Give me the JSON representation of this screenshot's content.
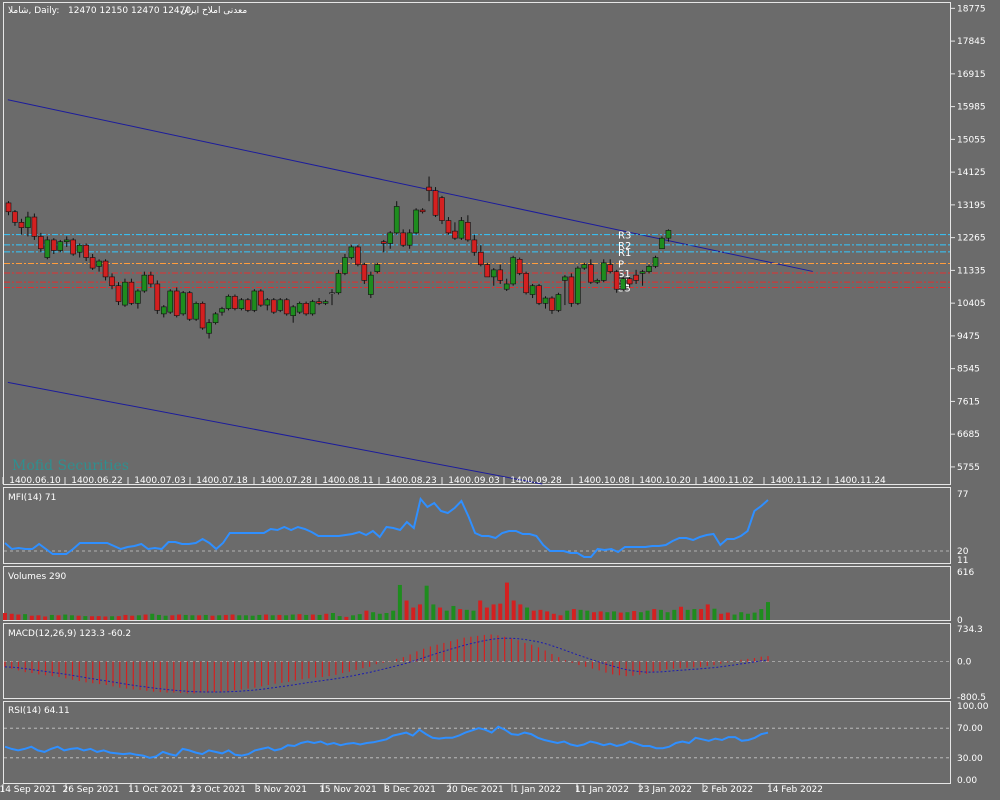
{
  "header": {
    "symbol": "شاملا, Daily:",
    "ohlc": "12470 12150 12470 12470",
    "name": "معدنی املاح ایران"
  },
  "watermark": "Mofid Securities",
  "colors": {
    "background": "#6b6b6b",
    "bull": "#1e8c1e",
    "bear": "#d42020",
    "trendline": "#1c1c9c",
    "pivot_r": "#33c8ff",
    "pivot_s": "#e03030",
    "pivot_p": "#ff9d3d",
    "indicator_line": "#2f8fff",
    "macd_signal": "#1c1cb0",
    "grid_level": "#c8c8c8"
  },
  "chart_data": [
    {
      "panel": "price",
      "type": "candlestick",
      "y_ticks": [
        18775,
        17845,
        16915,
        15985,
        15055,
        14125,
        13195,
        12265,
        11335,
        10405,
        9475,
        8545,
        7615,
        6685,
        5755
      ],
      "ylim": [
        5270,
        18870
      ],
      "x_labels_top": [
        "1400.06.10",
        "1400.06.22",
        "1400.07.03",
        "1400.07.18",
        "1400.07.28",
        "1400.08.11",
        "1400.08.23",
        "1400.09.03",
        "1400.09.28",
        "1400.10.08",
        "1400.10.20",
        "1400.11.02",
        "1400.11.12",
        "1400.11.24"
      ],
      "x_labels_bottom": [
        "14 Sep 2021",
        "26 Sep 2021",
        "11 Oct 2021",
        "23 Oct 2021",
        "3 Nov 2021",
        "15 Nov 2021",
        "8 Dec 2021",
        "20 Dec 2021",
        "1 Jan 2022",
        "11 Jan 2022",
        "23 Jan 2022",
        "2 Feb 2022",
        "14 Feb 2022"
      ],
      "candles": [
        [
          13250,
          13300,
          12900,
          13000
        ],
        [
          13000,
          13050,
          12600,
          12700
        ],
        [
          12700,
          12800,
          12350,
          12550
        ],
        [
          12550,
          13000,
          12300,
          12850
        ],
        [
          12850,
          12950,
          12200,
          12300
        ],
        [
          12300,
          12400,
          11850,
          11950
        ],
        [
          11700,
          12300,
          11650,
          12200
        ],
        [
          12200,
          12250,
          11800,
          11900
        ],
        [
          11900,
          12200,
          11850,
          12150
        ],
        [
          12150,
          12300,
          12000,
          12200
        ],
        [
          12200,
          12250,
          11750,
          11800
        ],
        [
          11850,
          12100,
          11700,
          12050
        ],
        [
          12050,
          12100,
          11600,
          11700
        ],
        [
          11700,
          11800,
          11350,
          11400
        ],
        [
          11450,
          11650,
          11300,
          11600
        ],
        [
          11600,
          11650,
          11050,
          11150
        ],
        [
          11150,
          11250,
          10800,
          10900
        ],
        [
          10900,
          11000,
          10350,
          10450
        ],
        [
          10350,
          11100,
          10300,
          11000
        ],
        [
          11000,
          11100,
          10350,
          10400
        ],
        [
          10400,
          10800,
          10250,
          10750
        ],
        [
          10750,
          11300,
          10700,
          11200
        ],
        [
          11200,
          11300,
          10850,
          10950
        ],
        [
          10950,
          11050,
          10100,
          10200
        ],
        [
          10100,
          10350,
          10000,
          10300
        ],
        [
          10150,
          10800,
          10100,
          10750
        ],
        [
          10750,
          10850,
          10000,
          10050
        ],
        [
          10100,
          10750,
          10050,
          10700
        ],
        [
          10700,
          10750,
          9900,
          9950
        ],
        [
          9950,
          10450,
          9900,
          10400
        ],
        [
          10400,
          10450,
          9650,
          9700
        ],
        [
          9550,
          9950,
          9400,
          9850
        ],
        [
          9850,
          10150,
          9800,
          10100
        ],
        [
          10150,
          10300,
          10050,
          10250
        ],
        [
          10250,
          10650,
          10200,
          10600
        ],
        [
          10600,
          10650,
          10200,
          10250
        ],
        [
          10250,
          10550,
          10200,
          10500
        ],
        [
          10500,
          10550,
          10150,
          10200
        ],
        [
          10200,
          10800,
          10150,
          10750
        ],
        [
          10750,
          10800,
          10300,
          10350
        ],
        [
          10350,
          10550,
          10200,
          10500
        ],
        [
          10500,
          10550,
          10100,
          10150
        ],
        [
          10200,
          10550,
          10150,
          10500
        ],
        [
          10500,
          10550,
          10050,
          10100
        ],
        [
          10050,
          10350,
          9850,
          10300
        ],
        [
          10150,
          10450,
          10100,
          10400
        ],
        [
          10400,
          10450,
          10050,
          10100
        ],
        [
          10100,
          10500,
          10050,
          10450
        ],
        [
          10450,
          10550,
          10350,
          10400
        ],
        [
          10400,
          10500,
          10350,
          10450
        ],
        [
          10700,
          10800,
          10350,
          10700
        ],
        [
          10700,
          11350,
          10650,
          11250
        ],
        [
          11250,
          11800,
          11200,
          11700
        ],
        [
          11700,
          12050,
          11650,
          12000
        ],
        [
          12000,
          12050,
          11450,
          11500
        ],
        [
          11500,
          11550,
          10950,
          11050
        ],
        [
          10650,
          11300,
          10550,
          11200
        ],
        [
          11300,
          11550,
          11250,
          11500
        ],
        [
          12150,
          12200,
          11850,
          12100
        ],
        [
          12100,
          12450,
          11950,
          12400
        ],
        [
          12400,
          13300,
          12350,
          13150
        ],
        [
          12400,
          12500,
          12000,
          12050
        ],
        [
          12050,
          12500,
          11950,
          12400
        ],
        [
          12400,
          13100,
          12350,
          13050
        ],
        [
          13050,
          13100,
          12950,
          13000
        ],
        [
          13700,
          14000,
          13300,
          13600
        ],
        [
          13600,
          13700,
          12850,
          12900
        ],
        [
          13400,
          13450,
          12650,
          12750
        ],
        [
          12750,
          12850,
          12350,
          12400
        ],
        [
          12450,
          12700,
          12200,
          12250
        ],
        [
          12250,
          12850,
          12200,
          12750
        ],
        [
          12700,
          12900,
          12150,
          12200
        ],
        [
          12200,
          12350,
          11750,
          11850
        ],
        [
          11850,
          12050,
          11450,
          11500
        ],
        [
          11500,
          11550,
          11150,
          11150
        ],
        [
          11150,
          11400,
          10900,
          11350
        ],
        [
          11350,
          11500,
          10950,
          11050
        ],
        [
          10800,
          11100,
          10750,
          10950
        ],
        [
          10950,
          11750,
          10900,
          11700
        ],
        [
          11650,
          11700,
          11200,
          11250
        ],
        [
          11250,
          11300,
          10650,
          10700
        ],
        [
          10650,
          10950,
          10550,
          10900
        ],
        [
          10900,
          10950,
          10350,
          10400
        ],
        [
          10400,
          10600,
          10250,
          10550
        ],
        [
          10550,
          10600,
          10100,
          10200
        ],
        [
          10200,
          10700,
          10150,
          10650
        ],
        [
          11050,
          11200,
          10350,
          11150
        ],
        [
          11150,
          11250,
          10300,
          10400
        ],
        [
          10400,
          11450,
          10350,
          11400
        ],
        [
          11400,
          11550,
          11350,
          11500
        ],
        [
          11500,
          11650,
          10950,
          11000
        ],
        [
          11000,
          11100,
          10950,
          11050
        ],
        [
          11050,
          11650,
          11000,
          11550
        ],
        [
          11500,
          11650,
          11250,
          11300
        ],
        [
          11300,
          11350,
          10700,
          10800
        ],
        [
          10800,
          11150,
          10750,
          11100
        ],
        [
          11100,
          11150,
          10850,
          10950
        ],
        [
          11200,
          11350,
          10950,
          11050
        ],
        [
          11250,
          11350,
          10900,
          11300
        ],
        [
          11300,
          11500,
          11250,
          11450
        ],
        [
          11450,
          11750,
          11400,
          11700
        ],
        [
          11950,
          12300,
          11950,
          12250
        ],
        [
          12250,
          12500,
          12150,
          12470
        ]
      ],
      "trendlines": [
        {
          "from_index": -0.1,
          "from_price": 16180,
          "to_index": 124.3,
          "to_price": 11305
        },
        {
          "from_index": -0.1,
          "from_price": 8155,
          "to_index": 82.5,
          "to_price": 5270
        }
      ],
      "pivots": [
        {
          "name": "R3",
          "value": 12350,
          "kind": "r"
        },
        {
          "name": "R2",
          "value": 12060,
          "kind": "r"
        },
        {
          "name": "R1",
          "value": 11860,
          "kind": "r"
        },
        {
          "name": "P",
          "value": 11530,
          "kind": "p"
        },
        {
          "name": "S1",
          "value": 11260,
          "kind": "s"
        },
        {
          "name": "S2",
          "value": 11000,
          "kind": "s"
        },
        {
          "name": "S3",
          "value": 10850,
          "kind": "s"
        }
      ]
    },
    {
      "panel": "mfi",
      "type": "line",
      "label": "MFI(14) 71",
      "ylim": [
        11,
        77
      ],
      "y_ticks": [
        77,
        20,
        11
      ],
      "levels": [
        20
      ],
      "values": [
        28,
        22,
        23,
        22,
        22,
        27,
        22,
        17,
        17,
        17,
        22,
        28,
        28,
        28,
        28,
        28,
        25,
        22,
        24,
        25,
        27,
        22,
        23,
        22,
        29,
        29,
        27,
        27,
        28,
        32,
        28,
        22,
        28,
        38,
        38,
        38,
        38,
        38,
        38,
        42,
        41,
        44,
        41,
        44,
        42,
        39,
        35,
        35,
        35,
        35,
        36,
        37,
        39,
        36,
        40,
        34,
        44,
        43,
        41,
        49,
        43,
        72,
        64,
        68,
        60,
        58,
        63,
        70,
        55,
        38,
        35,
        35,
        33,
        38,
        40,
        40,
        37,
        37,
        35,
        26,
        20,
        20,
        20,
        18,
        18,
        14,
        14,
        22,
        21,
        22,
        19,
        24,
        24,
        24,
        24,
        25,
        25,
        26,
        30,
        33,
        33,
        31,
        34,
        36,
        37,
        26,
        32,
        32,
        35,
        40,
        60,
        65,
        71
      ]
    },
    {
      "panel": "volume",
      "type": "bar",
      "label": "Volumes 290",
      "ylim": [
        0,
        616
      ],
      "y_ticks": [
        616,
        0
      ],
      "values": [
        90,
        80,
        70,
        75,
        55,
        60,
        45,
        65,
        60,
        70,
        60,
        55,
        50,
        48,
        50,
        45,
        48,
        50,
        65,
        55,
        60,
        70,
        80,
        65,
        55,
        60,
        70,
        65,
        60,
        60,
        65,
        55,
        60,
        65,
        70,
        60,
        60,
        55,
        65,
        70,
        60,
        65,
        60,
        70,
        75,
        65,
        70,
        65,
        80,
        90,
        50,
        40,
        60,
        75,
        120,
        100,
        80,
        90,
        120,
        450,
        250,
        160,
        200,
        440,
        200,
        160,
        120,
        180,
        140,
        130,
        120,
        250,
        160,
        200,
        210,
        480,
        250,
        200,
        160,
        120,
        130,
        110,
        80,
        60,
        120,
        140,
        130,
        120,
        100,
        110,
        100,
        110,
        95,
        100,
        115,
        100,
        120,
        140,
        130,
        100,
        130,
        170,
        130,
        140,
        140,
        200,
        145,
        80,
        95,
        70,
        100,
        80,
        95,
        140,
        230
      ]
    },
    {
      "panel": "macd",
      "type": "histogram+line",
      "label": "MACD(12,26,9) 123.3 -60.2",
      "ylim": [
        -800.5,
        734.3
      ],
      "y_ticks": [
        734.3,
        0.0,
        -800.5
      ],
      "histogram": [
        -120,
        -160,
        -200,
        -240,
        -260,
        -290,
        -310,
        -330,
        -350,
        -380,
        -410,
        -440,
        -470,
        -490,
        -510,
        -530,
        -560,
        -590,
        -610,
        -630,
        -640,
        -660,
        -680,
        -690,
        -700,
        -700,
        -710,
        -720,
        -720,
        -700,
        -700,
        -690,
        -680,
        -670,
        -650,
        -630,
        -610,
        -590,
        -560,
        -530,
        -500,
        -480,
        -460,
        -430,
        -400,
        -380,
        -360,
        -350,
        -330,
        -300,
        -260,
        -230,
        -190,
        -150,
        -120,
        -60,
        -30,
        10,
        60,
        100,
        160,
        230,
        290,
        340,
        380,
        420,
        460,
        500,
        540,
        560,
        580,
        600,
        610,
        590,
        560,
        520,
        480,
        420,
        380,
        320,
        250,
        170,
        100,
        30,
        -30,
        -80,
        -120,
        -160,
        -200,
        -250,
        -290,
        -310,
        -330,
        -320,
        -300,
        -280,
        -240,
        -210,
        -180,
        -160,
        -150,
        -140,
        -130,
        -120,
        -100,
        -80,
        -50,
        -20,
        10,
        40,
        60,
        80,
        110,
        123
      ]
    },
    {
      "panel": "rsi",
      "type": "line",
      "label": "RSI(14) 64.11",
      "ylim": [
        0,
        100
      ],
      "y_ticks": [
        100.0,
        70.0,
        30.0,
        0.0
      ],
      "levels": [
        70,
        30
      ],
      "values": [
        45,
        42,
        40,
        42,
        45,
        40,
        38,
        42,
        45,
        40,
        42,
        43,
        40,
        42,
        38,
        40,
        37,
        36,
        35,
        36,
        34,
        33,
        30,
        32,
        38,
        35,
        33,
        42,
        40,
        37,
        35,
        40,
        38,
        36,
        40,
        34,
        33,
        35,
        40,
        42,
        44,
        40,
        42,
        47,
        46,
        50,
        52,
        50,
        52,
        48,
        50,
        47,
        49,
        50,
        48,
        50,
        51,
        53,
        55,
        60,
        62,
        64,
        60,
        68,
        62,
        57,
        56,
        57,
        57,
        60,
        64,
        67,
        70,
        68,
        64,
        72,
        68,
        62,
        61,
        64,
        62,
        57,
        54,
        52,
        50,
        52,
        48,
        46,
        48,
        52,
        50,
        47,
        49,
        46,
        48,
        52,
        49,
        46,
        46,
        43,
        43,
        45,
        50,
        52,
        50,
        57,
        55,
        53,
        56,
        54,
        58,
        58,
        53,
        54,
        57,
        62,
        64
      ]
    }
  ]
}
